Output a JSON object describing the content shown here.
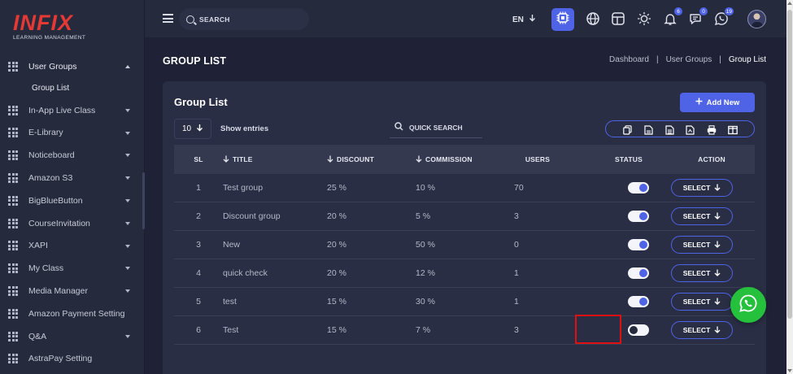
{
  "logo": {
    "brand": "INFIX",
    "tagline": "LEARNING MANAGEMENT"
  },
  "sidebar": {
    "items": [
      {
        "label": "User Groups",
        "open": true
      },
      {
        "label": "In-App Live Class"
      },
      {
        "label": "E-Library"
      },
      {
        "label": "Noticeboard"
      },
      {
        "label": "Amazon S3"
      },
      {
        "label": "BigBlueButton"
      },
      {
        "label": "CourseInvitation"
      },
      {
        "label": "XAPI"
      },
      {
        "label": "My Class"
      },
      {
        "label": "Media Manager"
      },
      {
        "label": "Amazon Payment Setting"
      },
      {
        "label": "Q&A"
      },
      {
        "label": "AstraPay Setting"
      }
    ],
    "sub_items": [
      {
        "label": "Group List"
      }
    ]
  },
  "topbar": {
    "search_placeholder": "SEARCH",
    "language": "EN",
    "badges": {
      "notifications": "6",
      "messages": "0",
      "whatsapp": "19"
    }
  },
  "page": {
    "title": "GROUP LIST",
    "breadcrumb": [
      "Dashboard",
      "User Groups",
      "Group List"
    ]
  },
  "card": {
    "title": "Group List",
    "add_button": "Add New",
    "entries_value": "10",
    "entries_label": "Show entries",
    "quick_search": "QUICK SEARCH",
    "export_icons": [
      "copy-icon",
      "csv-icon",
      "excel-icon",
      "pdf-icon",
      "print-icon",
      "columns-icon"
    ]
  },
  "table": {
    "headers": [
      "SL",
      "TITLE",
      "DISCOUNT",
      "COMMISSION",
      "USERS",
      "STATUS",
      "ACTION"
    ],
    "rows": [
      {
        "sl": "1",
        "title": "Test group",
        "discount": "25 %",
        "commission": "10 %",
        "users": "70",
        "status": true,
        "action": "SELECT"
      },
      {
        "sl": "2",
        "title": "Discount group",
        "discount": "20 %",
        "commission": "5 %",
        "users": "3",
        "status": true,
        "action": "SELECT"
      },
      {
        "sl": "3",
        "title": "New",
        "discount": "20 %",
        "commission": "50 %",
        "users": "0",
        "status": true,
        "action": "SELECT"
      },
      {
        "sl": "4",
        "title": "quick check",
        "discount": "20 %",
        "commission": "12 %",
        "users": "1",
        "status": true,
        "action": "SELECT"
      },
      {
        "sl": "5",
        "title": "test",
        "discount": "15 %",
        "commission": "30 %",
        "users": "1",
        "status": true,
        "action": "SELECT"
      },
      {
        "sl": "6",
        "title": "Test",
        "discount": "15 %",
        "commission": "7 %",
        "users": "3",
        "status": false,
        "action": "SELECT"
      }
    ]
  },
  "colors": {
    "accent": "#4f63e7",
    "background": "#1f2236",
    "panel": "#2a2e44",
    "highlight": "#e01010",
    "whatsapp": "#25c13d",
    "logo": "#e53935"
  }
}
